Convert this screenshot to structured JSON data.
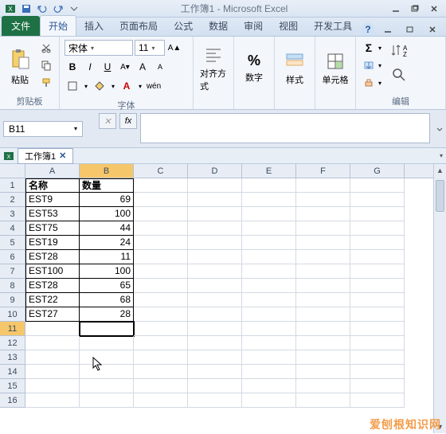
{
  "title": "工作簿1 - Microsoft Excel",
  "tabs": {
    "file": "文件",
    "items": [
      "开始",
      "插入",
      "页面布局",
      "公式",
      "数据",
      "审阅",
      "视图",
      "开发工具"
    ],
    "active": 0
  },
  "ribbon": {
    "clipboard": {
      "paste": "粘贴",
      "label": "剪贴板"
    },
    "font": {
      "name": "宋体",
      "size": "11",
      "buttons": {
        "bold": "B",
        "italic": "I",
        "underline": "U"
      },
      "label": "字体"
    },
    "align": {
      "label": "对齐方式"
    },
    "number": {
      "symbol": "%",
      "label": "数字"
    },
    "styles": {
      "label": "样式"
    },
    "cells": {
      "label": "单元格"
    },
    "editing": {
      "sigma": "Σ",
      "label": "编辑"
    }
  },
  "namebox": "B11",
  "fx": "fx",
  "workbook_tab": "工作簿1",
  "columns": [
    "A",
    "B",
    "C",
    "D",
    "E",
    "F",
    "G"
  ],
  "rows": [
    1,
    2,
    3,
    4,
    5,
    6,
    7,
    8,
    9,
    10,
    11,
    12,
    13,
    14,
    15,
    16
  ],
  "selected_cell": {
    "row": 11,
    "col": "B"
  },
  "headers": {
    "a": "名称",
    "b": "数量"
  },
  "data": [
    {
      "name": "EST9",
      "qty": 69
    },
    {
      "name": "EST53",
      "qty": 100
    },
    {
      "name": "EST75",
      "qty": 44
    },
    {
      "name": "EST19",
      "qty": 24
    },
    {
      "name": "EST28",
      "qty": 11
    },
    {
      "name": "EST100",
      "qty": 100
    },
    {
      "name": "EST28",
      "qty": 65
    },
    {
      "name": "EST22",
      "qty": 68
    },
    {
      "name": "EST27",
      "qty": 28
    }
  ],
  "watermark": "爱刨根知识网"
}
